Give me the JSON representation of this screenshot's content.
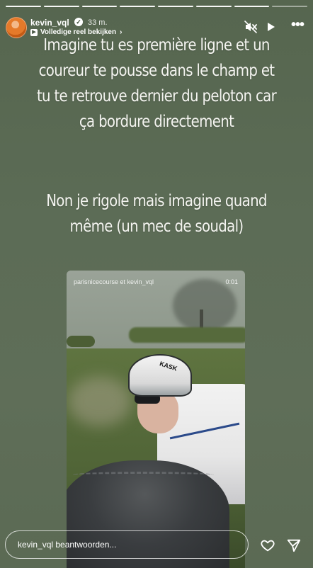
{
  "progress": {
    "segments_total": 8,
    "segments_done": 7
  },
  "header": {
    "username": "kevin_vql",
    "time_ago": "33 m.",
    "reel_link_label": "Volledige reel bekijken"
  },
  "story_text": {
    "line1": "Imagine tu es première ligne et un coureur te pousse dans le champ et tu te retrouve dernier du peloton car ça bordure directement",
    "line2": "Non je rigole mais imagine quand même (un mec de soudal)"
  },
  "reel": {
    "caption": "parisnicecourse et kevin_vql",
    "timestamp": "0:01",
    "helmet_logo": "KASK"
  },
  "footer": {
    "reply_placeholder": "kevin_vql beantwoorden..."
  },
  "colors": {
    "background": "#5b6a55",
    "text": "#ffffff"
  }
}
